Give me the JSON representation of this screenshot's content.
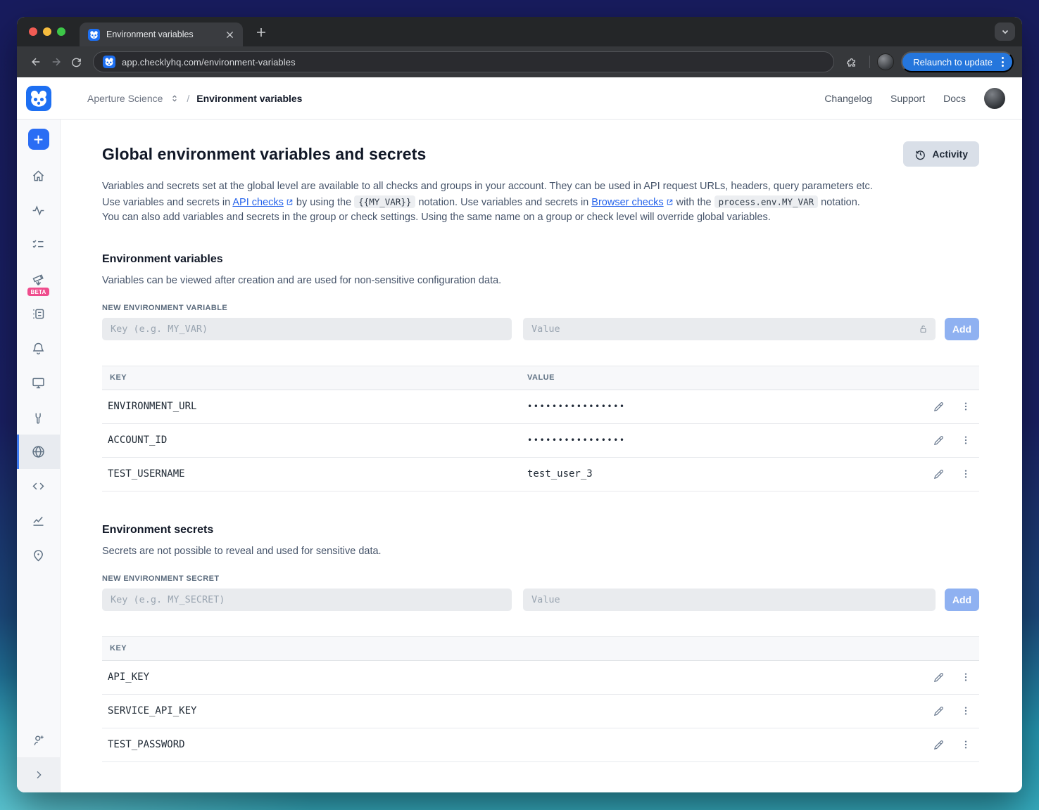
{
  "browser": {
    "tab_title": "Environment variables",
    "url": "app.checklyhq.com/environment-variables",
    "relaunch_label": "Relaunch to update"
  },
  "header": {
    "account_name": "Aperture Science",
    "breadcrumb_current": "Environment variables",
    "links": {
      "changelog": "Changelog",
      "support": "Support",
      "docs": "Docs"
    }
  },
  "sidebar": {
    "beta_badge": "BETA",
    "items": [
      "create",
      "home",
      "monitoring",
      "checks",
      "explore-beta",
      "test-sessions",
      "alerts",
      "dashboards",
      "maintenance",
      "environment-variables",
      "snippets",
      "analytics",
      "private-locations",
      "invite-user",
      "collapse"
    ],
    "active_item": "environment-variables"
  },
  "page": {
    "title": "Global environment variables and secrets",
    "activity_button": "Activity",
    "description": {
      "part1": "Variables and secrets set at the global level are available to all checks and groups in your account. They can be used in API request URLs, headers, query parameters etc. Use variables and secrets in ",
      "link1": "API checks",
      "part2": " by using the ",
      "code1": "{{MY_VAR}}",
      "part3": " notation. Use variables and secrets in ",
      "link2": "Browser checks",
      "part4": " with the ",
      "code2": "process.env.MY_VAR",
      "part5": " notation. You can also add variables and secrets in the group or check settings. Using the same name on a group or check level will override global variables."
    }
  },
  "variables_section": {
    "heading": "Environment variables",
    "subtext": "Variables can be viewed after creation and are used for non-sensitive configuration data.",
    "form_label": "NEW ENVIRONMENT VARIABLE",
    "key_placeholder": "Key (e.g. MY_VAR)",
    "value_placeholder": "Value",
    "add_label": "Add",
    "table": {
      "key_header": "KEY",
      "value_header": "VALUE",
      "rows": [
        {
          "key": "ENVIRONMENT_URL",
          "value": "••••••••••••••••",
          "masked": true
        },
        {
          "key": "ACCOUNT_ID",
          "value": "••••••••••••••••",
          "masked": true
        },
        {
          "key": "TEST_USERNAME",
          "value": "test_user_3",
          "masked": false
        }
      ]
    }
  },
  "secrets_section": {
    "heading": "Environment secrets",
    "subtext": "Secrets are not possible to reveal and used for sensitive data.",
    "form_label": "NEW ENVIRONMENT SECRET",
    "key_placeholder": "Key (e.g. MY_SECRET)",
    "value_placeholder": "Value",
    "add_label": "Add",
    "table": {
      "key_header": "KEY",
      "rows": [
        {
          "key": "API_KEY"
        },
        {
          "key": "SERVICE_API_KEY"
        },
        {
          "key": "TEST_PASSWORD"
        }
      ]
    }
  },
  "colors": {
    "accent_blue": "#2a6df4",
    "beta_pink": "#ef4d8d",
    "relaunch_blue": "#2576dc",
    "add_button_disabled": "#8fb1f1",
    "desktop_top": "#181c5e",
    "desktop_bottom": "#35abbe",
    "sidebar_bg": "#f8f9fb",
    "active_item_bg": "#e8ebf0"
  }
}
